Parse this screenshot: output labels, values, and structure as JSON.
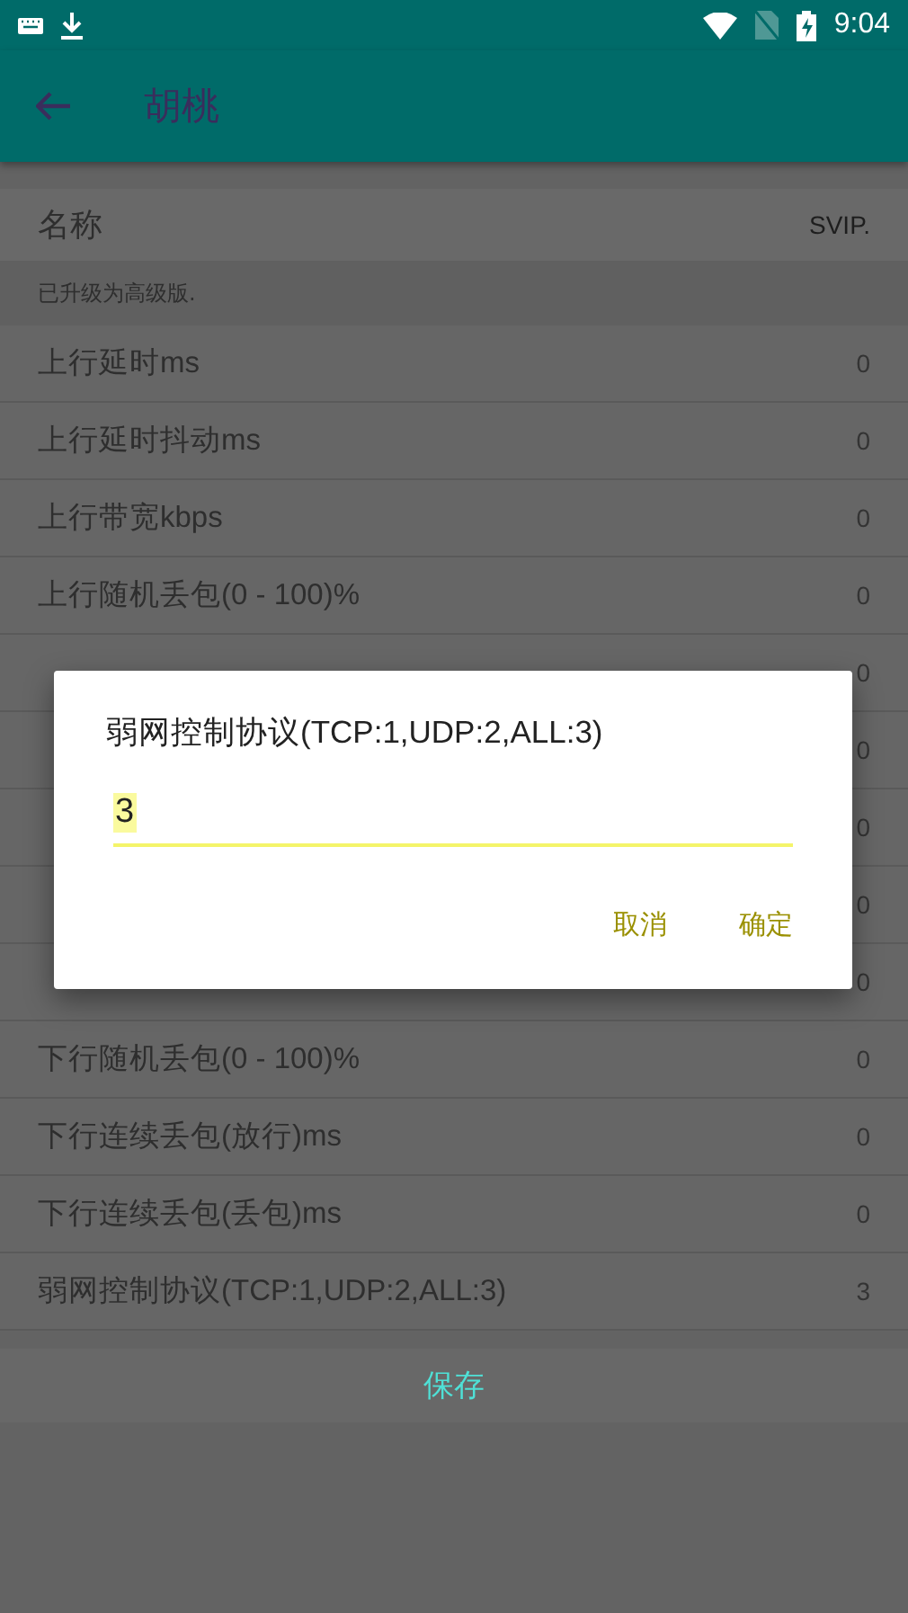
{
  "status_bar": {
    "time": "9:04"
  },
  "toolbar": {
    "title": "胡桃"
  },
  "header": {
    "label": "名称",
    "value": "SVIP."
  },
  "notice": "已升级为高级版.",
  "rows": [
    {
      "label": "上行延时ms",
      "value": "0"
    },
    {
      "label": "上行延时抖动ms",
      "value": "0"
    },
    {
      "label": "上行带宽kbps",
      "value": "0"
    },
    {
      "label": "上行随机丢包(0 - 100)%",
      "value": "0"
    },
    {
      "value": "0"
    },
    {
      "value": "0"
    },
    {
      "value": "0"
    },
    {
      "value": "0"
    },
    {
      "value": "0"
    },
    {
      "label": "下行随机丢包(0 - 100)%",
      "value": "0"
    },
    {
      "label": "下行连续丢包(放行)ms",
      "value": "0"
    },
    {
      "label": "下行连续丢包(丢包)ms",
      "value": "0"
    },
    {
      "label": "弱网控制协议(TCP:1,UDP:2,ALL:3)",
      "value": "3"
    }
  ],
  "save_button": "保存",
  "dialog": {
    "title": "弱网控制协议(TCP:1,UDP:2,ALL:3)",
    "value": "3",
    "buttons": [
      "取消",
      "确定"
    ]
  }
}
